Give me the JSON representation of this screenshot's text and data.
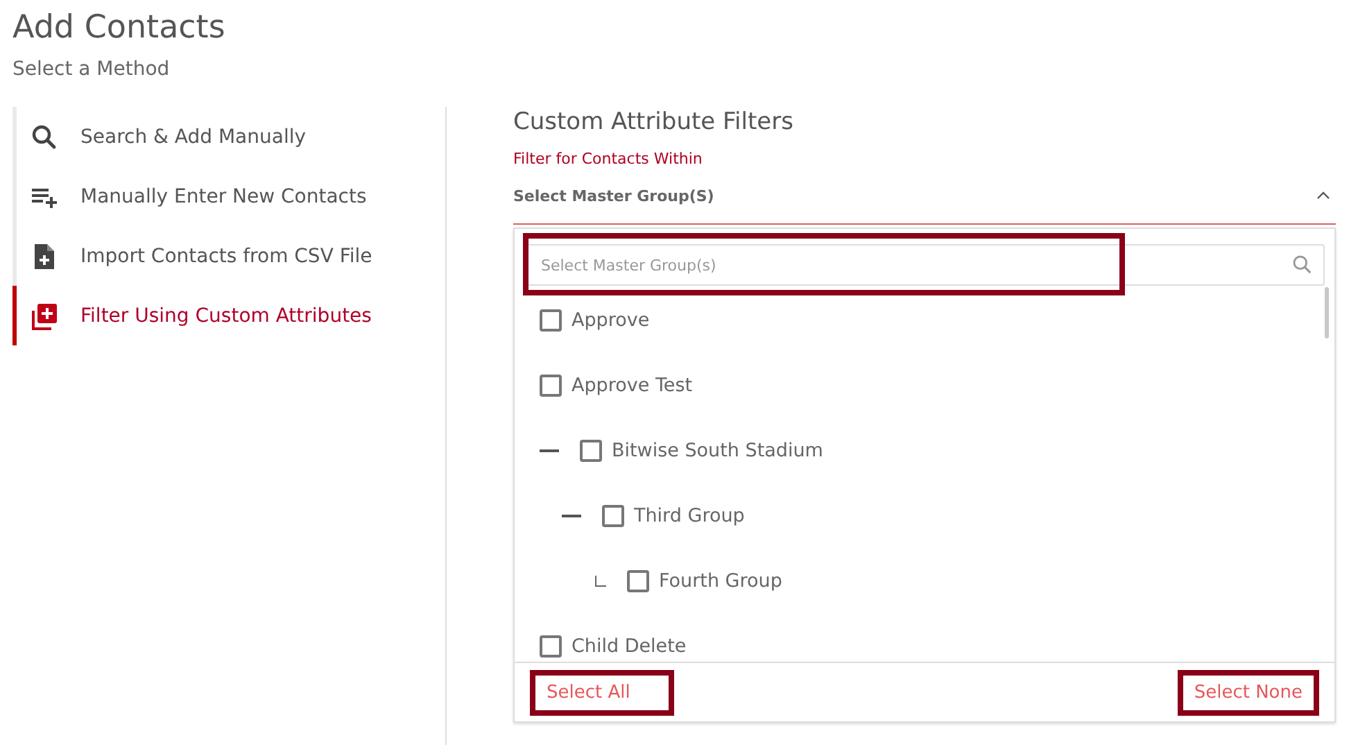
{
  "page": {
    "title": "Add Contacts",
    "subtitle": "Select a Method"
  },
  "methods": [
    {
      "label": "Search & Add Manually",
      "kind": "search",
      "selected": false
    },
    {
      "label": "Manually Enter New Contacts",
      "kind": "list-add",
      "selected": false
    },
    {
      "label": "Import Contacts from CSV File",
      "kind": "file-add",
      "selected": false
    },
    {
      "label": "Filter Using Custom Attributes",
      "kind": "stack-add",
      "selected": true
    }
  ],
  "panel": {
    "title": "Custom Attribute Filters",
    "hint": "Filter for Contacts Within",
    "dropdown": {
      "label": "Select Master Group(S)",
      "expanded": true,
      "search": {
        "placeholder": "Select Master Group(s)",
        "highlighted": true
      },
      "items": [
        {
          "label": "Approve",
          "checked": false
        },
        {
          "label": "Approve Test",
          "checked": false
        },
        {
          "label": "Bitwise South Stadium",
          "checked": false,
          "expanded": true,
          "children": [
            {
              "label": "Third Group",
              "checked": false,
              "expanded": true,
              "children": [
                {
                  "label": "Fourth Group",
                  "checked": false
                }
              ]
            }
          ]
        },
        {
          "label": "Child Delete",
          "checked": false
        }
      ],
      "select_all": {
        "label": "Select All",
        "highlighted": true
      },
      "select_none": {
        "label": "Select None",
        "highlighted": true
      }
    }
  }
}
